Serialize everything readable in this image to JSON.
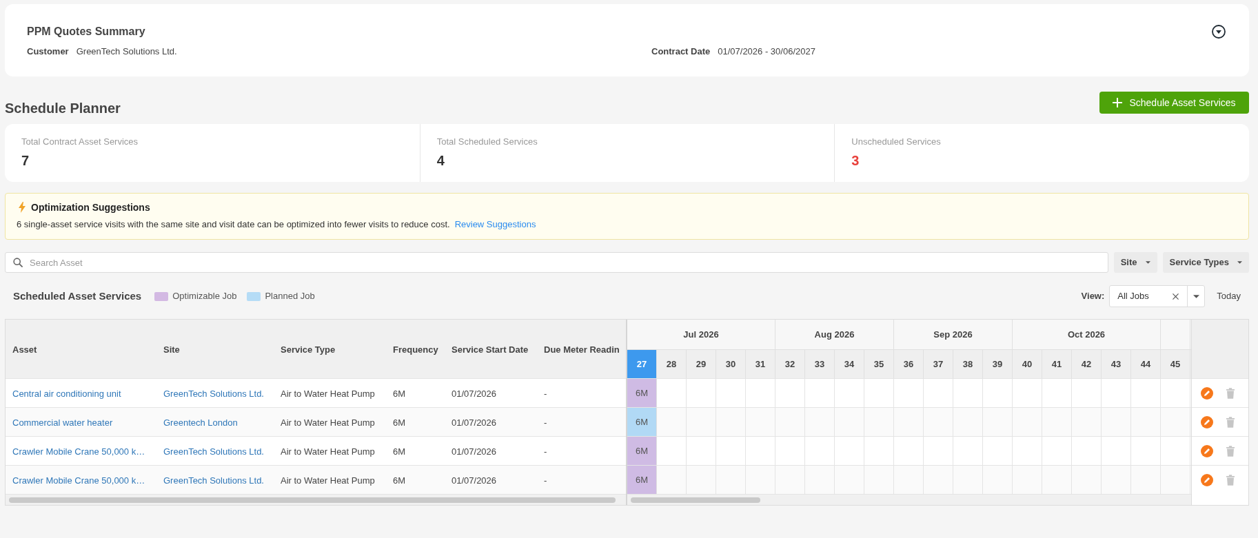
{
  "summary": {
    "title": "PPM Quotes Summary",
    "fields": [
      {
        "label": "Customer",
        "value": "GreenTech Solutions Ltd."
      },
      {
        "label": "Contract Date",
        "value": "01/07/2026 - 30/06/2027"
      }
    ]
  },
  "planner": {
    "title": "Schedule Planner",
    "action_button": "Schedule Asset Services"
  },
  "stats": [
    {
      "label": "Total Contract Asset Services",
      "value": "7",
      "kind": "count"
    },
    {
      "label": "Total Scheduled Services",
      "value": "4",
      "kind": "count"
    },
    {
      "label": "Unscheduled Services",
      "value": "3",
      "kind": "alert"
    }
  ],
  "suggestion": {
    "title": "Optimization Suggestions",
    "message": "6 single-asset service visits with the same site and visit date can be optimized into fewer visits to reduce cost.",
    "link": "Review Suggestions"
  },
  "search": {
    "placeholder": "Search Asset"
  },
  "filters": [
    {
      "label": "Site"
    },
    {
      "label": "Service Types"
    }
  ],
  "schedule": {
    "title": "Scheduled Asset Services",
    "legend": [
      {
        "label": "Optimizable Job",
        "color": "#d3b9e3"
      },
      {
        "label": "Planned Job",
        "color": "#b5dcf6"
      }
    ],
    "view": {
      "label": "View:",
      "value": "All Jobs"
    },
    "today_button": "Today"
  },
  "table": {
    "columns": [
      "Asset",
      "Site",
      "Service Type",
      "Frequency",
      "Service Start Date",
      "Due Meter Readin"
    ],
    "months": [
      {
        "label": "Jul 2026",
        "weeks": [
          {
            "label": "27",
            "selected": true
          },
          {
            "label": "28",
            "selected": false
          },
          {
            "label": "29",
            "selected": false
          },
          {
            "label": "30",
            "selected": false
          },
          {
            "label": "31",
            "selected": false
          }
        ]
      },
      {
        "label": "Aug 2026",
        "weeks": [
          {
            "label": "32",
            "selected": false
          },
          {
            "label": "33",
            "selected": false
          },
          {
            "label": "34",
            "selected": false
          },
          {
            "label": "35",
            "selected": false
          }
        ]
      },
      {
        "label": "Sep 2026",
        "weeks": [
          {
            "label": "36",
            "selected": false
          },
          {
            "label": "37",
            "selected": false
          },
          {
            "label": "38",
            "selected": false
          },
          {
            "label": "39",
            "selected": false
          }
        ]
      },
      {
        "label": "Oct 2026",
        "weeks": [
          {
            "label": "40",
            "selected": false
          },
          {
            "label": "41",
            "selected": false
          },
          {
            "label": "42",
            "selected": false
          },
          {
            "label": "43",
            "selected": false
          },
          {
            "label": "44",
            "selected": false
          }
        ]
      },
      {
        "weeks": [
          {
            "label": "45",
            "selected": false
          }
        ]
      }
    ],
    "rows": [
      {
        "asset": "Central air conditioning unit",
        "site": "GreenTech Solutions Ltd.",
        "service_type": "Air to Water Heat Pump",
        "frequency": "6M",
        "start_date": "01/07/2026",
        "due_meter_reading": "-",
        "timeline": [
          {
            "kind": "optimizable",
            "label": "6M"
          },
          {
            "kind": "empty"
          },
          {
            "kind": "empty"
          },
          {
            "kind": "empty"
          },
          {
            "kind": "empty"
          },
          {
            "kind": "empty"
          },
          {
            "kind": "empty"
          },
          {
            "kind": "empty"
          },
          {
            "kind": "empty"
          },
          {
            "kind": "empty"
          },
          {
            "kind": "empty"
          },
          {
            "kind": "empty"
          },
          {
            "kind": "empty"
          },
          {
            "kind": "empty"
          },
          {
            "kind": "empty"
          },
          {
            "kind": "empty"
          },
          {
            "kind": "empty"
          },
          {
            "kind": "empty"
          },
          {
            "kind": "empty"
          }
        ]
      },
      {
        "asset": "Commercial water heater",
        "site": "Greentech London",
        "service_type": "Air to Water Heat Pump",
        "frequency": "6M",
        "start_date": "01/07/2026",
        "due_meter_reading": "-",
        "timeline": [
          {
            "kind": "planned",
            "label": "6M"
          },
          {
            "kind": "empty"
          },
          {
            "kind": "empty"
          },
          {
            "kind": "empty"
          },
          {
            "kind": "empty"
          },
          {
            "kind": "empty"
          },
          {
            "kind": "empty"
          },
          {
            "kind": "empty"
          },
          {
            "kind": "empty"
          },
          {
            "kind": "empty"
          },
          {
            "kind": "empty"
          },
          {
            "kind": "empty"
          },
          {
            "kind": "empty"
          },
          {
            "kind": "empty"
          },
          {
            "kind": "empty"
          },
          {
            "kind": "empty"
          },
          {
            "kind": "empty"
          },
          {
            "kind": "empty"
          },
          {
            "kind": "empty"
          }
        ]
      },
      {
        "asset": "Crawler Mobile Crane 50,000 k…",
        "site": "GreenTech Solutions Ltd.",
        "service_type": "Air to Water Heat Pump",
        "frequency": "6M",
        "start_date": "01/07/2026",
        "due_meter_reading": "-",
        "timeline": [
          {
            "kind": "optimizable",
            "label": "6M"
          },
          {
            "kind": "empty"
          },
          {
            "kind": "empty"
          },
          {
            "kind": "empty"
          },
          {
            "kind": "empty"
          },
          {
            "kind": "empty"
          },
          {
            "kind": "empty"
          },
          {
            "kind": "empty"
          },
          {
            "kind": "empty"
          },
          {
            "kind": "empty"
          },
          {
            "kind": "empty"
          },
          {
            "kind": "empty"
          },
          {
            "kind": "empty"
          },
          {
            "kind": "empty"
          },
          {
            "kind": "empty"
          },
          {
            "kind": "empty"
          },
          {
            "kind": "empty"
          },
          {
            "kind": "empty"
          },
          {
            "kind": "empty"
          }
        ]
      },
      {
        "asset": "Crawler Mobile Crane 50,000 k…",
        "site": "GreenTech Solutions Ltd.",
        "service_type": "Air to Water Heat Pump",
        "frequency": "6M",
        "start_date": "01/07/2026",
        "due_meter_reading": "-",
        "timeline": [
          {
            "kind": "optimizable",
            "label": "6M"
          },
          {
            "kind": "empty"
          },
          {
            "kind": "empty"
          },
          {
            "kind": "empty"
          },
          {
            "kind": "empty"
          },
          {
            "kind": "empty"
          },
          {
            "kind": "empty"
          },
          {
            "kind": "empty"
          },
          {
            "kind": "empty"
          },
          {
            "kind": "empty"
          },
          {
            "kind": "empty"
          },
          {
            "kind": "empty"
          },
          {
            "kind": "empty"
          },
          {
            "kind": "empty"
          },
          {
            "kind": "empty"
          },
          {
            "kind": "empty"
          },
          {
            "kind": "empty"
          },
          {
            "kind": "empty"
          },
          {
            "kind": "empty"
          }
        ]
      }
    ]
  }
}
